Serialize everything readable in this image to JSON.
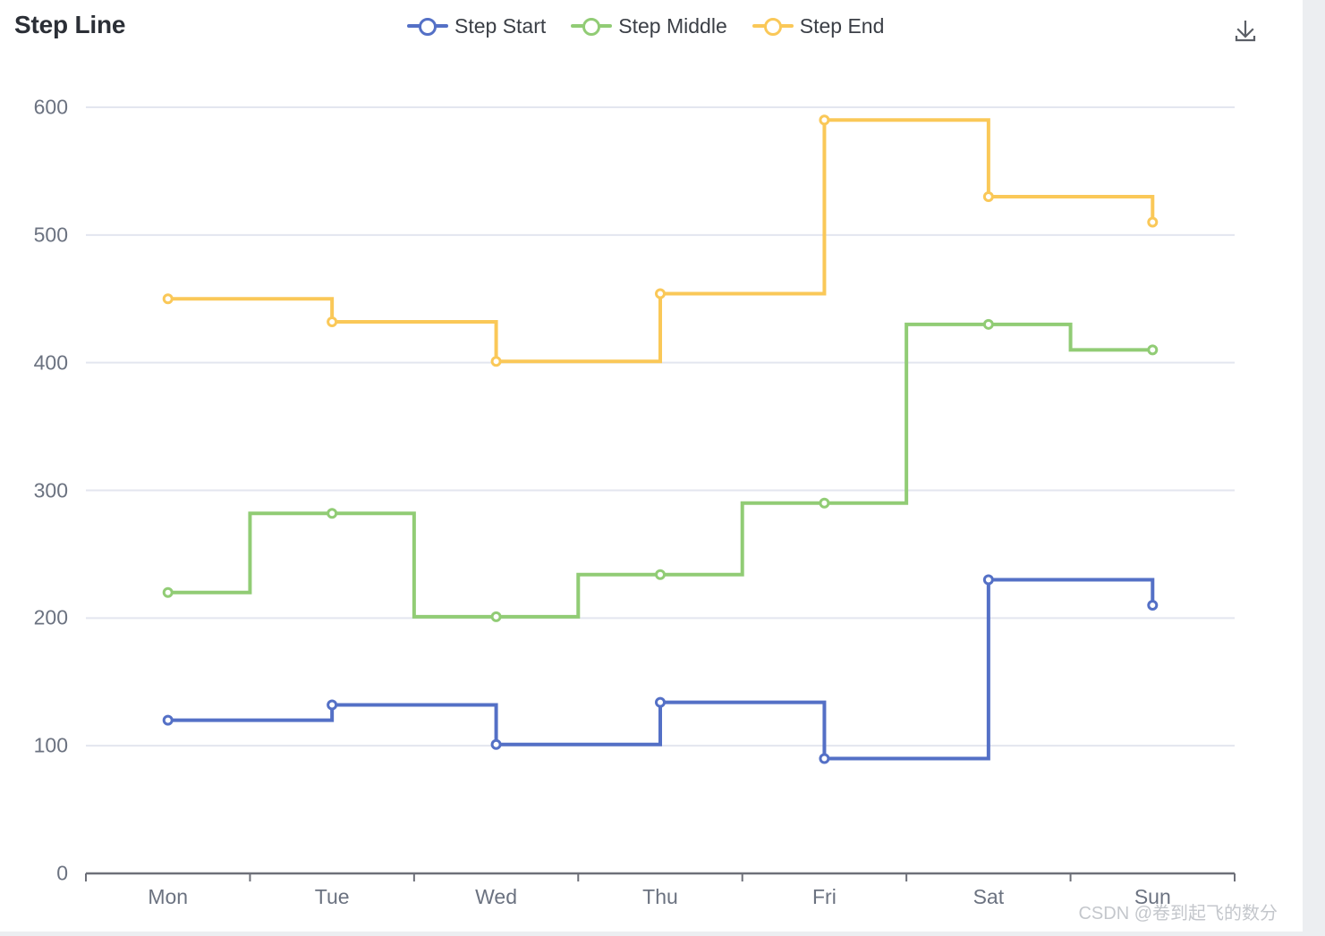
{
  "header": {
    "title": "Step Line",
    "toolbox_icon": "download-icon"
  },
  "legend": [
    {
      "label": "Step Start",
      "color": "#5470c6",
      "icon": "line-marker-icon"
    },
    {
      "label": "Step Middle",
      "color": "#91cc75",
      "icon": "line-marker-icon"
    },
    {
      "label": "Step End",
      "color": "#fac858",
      "icon": "line-marker-icon"
    }
  ],
  "watermark": "CSDN @卷到起飞的数分",
  "chart_data": {
    "type": "line",
    "subtype": "step",
    "title": "Step Line",
    "xlabel": "",
    "ylabel": "",
    "categories": [
      "Mon",
      "Tue",
      "Wed",
      "Thu",
      "Fri",
      "Sat",
      "Sun"
    ],
    "ylim": [
      0,
      600
    ],
    "y_ticks": [
      0,
      100,
      200,
      300,
      400,
      500,
      600
    ],
    "y_tick_labels": [
      "0",
      "100",
      "200",
      "300",
      "400",
      "500",
      "600"
    ],
    "grid": true,
    "legend_position": "top-center",
    "series": [
      {
        "name": "Step Start",
        "step": "start",
        "color": "#5470c6",
        "values": [
          120,
          132,
          101,
          134,
          90,
          230,
          210
        ]
      },
      {
        "name": "Step Middle",
        "step": "middle",
        "color": "#91cc75",
        "values": [
          220,
          282,
          201,
          234,
          290,
          430,
          410
        ]
      },
      {
        "name": "Step End",
        "step": "end",
        "color": "#fac858",
        "values": [
          450,
          432,
          401,
          454,
          590,
          530,
          510
        ]
      }
    ]
  }
}
